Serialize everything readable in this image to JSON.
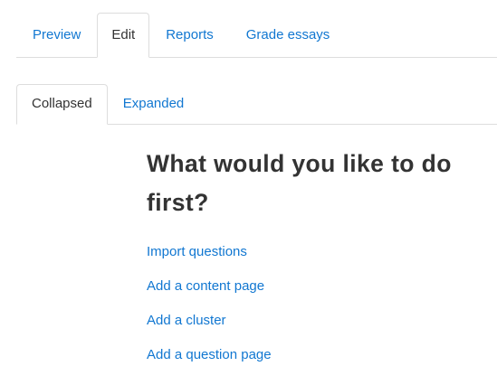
{
  "primary_tabs": [
    {
      "label": "Preview",
      "active": false
    },
    {
      "label": "Edit",
      "active": true
    },
    {
      "label": "Reports",
      "active": false
    },
    {
      "label": "Grade essays",
      "active": false
    }
  ],
  "secondary_tabs": [
    {
      "label": "Collapsed",
      "active": true
    },
    {
      "label": "Expanded",
      "active": false
    }
  ],
  "main": {
    "heading_line1": "What would you like to do",
    "heading_line2": "first?",
    "links": [
      {
        "label": "Import questions"
      },
      {
        "label": "Add a content page"
      },
      {
        "label": "Add a cluster"
      },
      {
        "label": "Add a question page"
      }
    ]
  },
  "colors": {
    "link": "#1177d1",
    "text": "#333333",
    "border": "#dddddd"
  }
}
